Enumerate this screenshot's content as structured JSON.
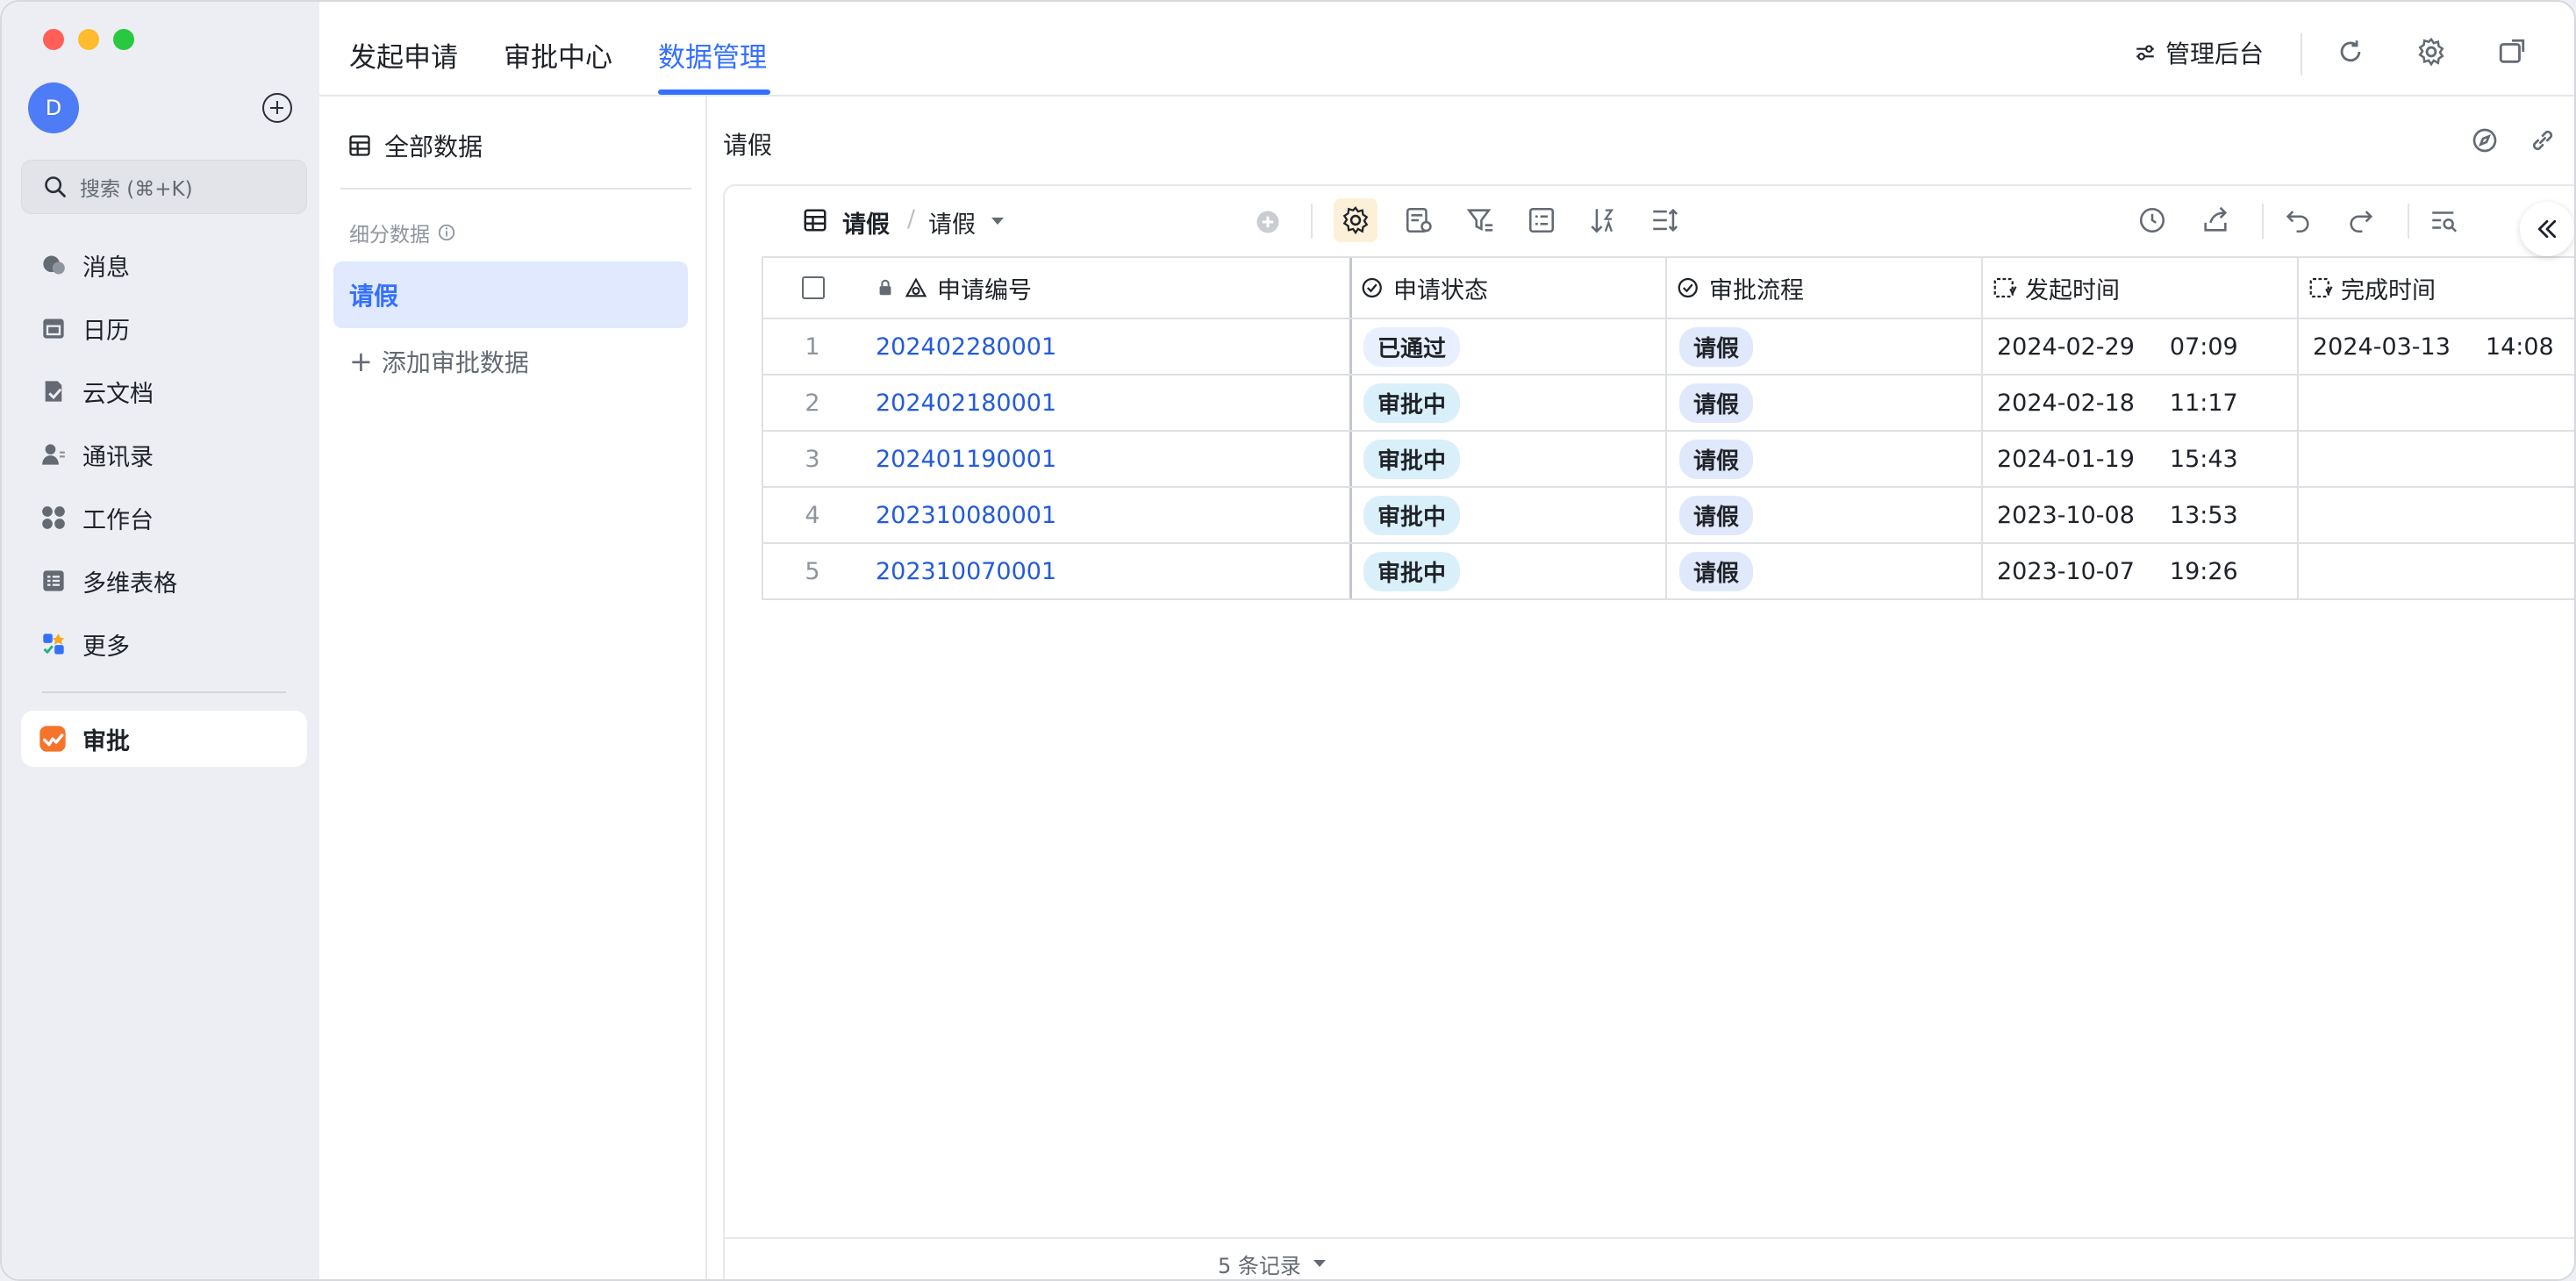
{
  "sidebar": {
    "avatar_letter": "D",
    "search_placeholder": "搜索 (⌘+K)",
    "items": [
      {
        "label": "消息",
        "icon": "chat-icon"
      },
      {
        "label": "日历",
        "icon": "calendar-icon"
      },
      {
        "label": "云文档",
        "icon": "document-icon"
      },
      {
        "label": "通讯录",
        "icon": "contacts-icon"
      },
      {
        "label": "工作台",
        "icon": "workspace-icon"
      },
      {
        "label": "多维表格",
        "icon": "table-icon"
      },
      {
        "label": "更多",
        "icon": "more-icon"
      }
    ],
    "approval_label": "审批"
  },
  "topbar": {
    "tabs": [
      "发起申请",
      "审批中心",
      "数据管理"
    ],
    "active_tab": "数据管理",
    "admin_label": "管理后台"
  },
  "leftpanel": {
    "all_data_label": "全部数据",
    "subsection_label": "细分数据",
    "selected_item": "请假",
    "add_label": "添加审批数据"
  },
  "main": {
    "title": "请假",
    "breadcrumb": {
      "root": "请假",
      "view": "请假"
    },
    "columns": [
      "申请编号",
      "申请状态",
      "审批流程",
      "发起时间",
      "完成时间"
    ],
    "rows": [
      {
        "index": "1",
        "id": "202402280001",
        "status": "已通过",
        "process": "请假",
        "start_date": "2024-02-29",
        "start_time": "07:09",
        "end_date": "2024-03-13",
        "end_time": "14:08"
      },
      {
        "index": "2",
        "id": "202402180001",
        "status": "审批中",
        "process": "请假",
        "start_date": "2024-02-18",
        "start_time": "11:17",
        "end_date": "",
        "end_time": ""
      },
      {
        "index": "3",
        "id": "202401190001",
        "status": "审批中",
        "process": "请假",
        "start_date": "2024-01-19",
        "start_time": "15:43",
        "end_date": "",
        "end_time": ""
      },
      {
        "index": "4",
        "id": "202310080001",
        "status": "审批中",
        "process": "请假",
        "start_date": "2023-10-08",
        "start_time": "13:53",
        "end_date": "",
        "end_time": ""
      },
      {
        "index": "5",
        "id": "202310070001",
        "status": "审批中",
        "process": "请假",
        "start_date": "2023-10-07",
        "start_time": "19:26",
        "end_date": "",
        "end_time": ""
      }
    ],
    "record_count": "5 条记录"
  },
  "colors": {
    "accent": "#3370ff",
    "link": "#245bdb",
    "approval_brand": "#f5732a"
  }
}
